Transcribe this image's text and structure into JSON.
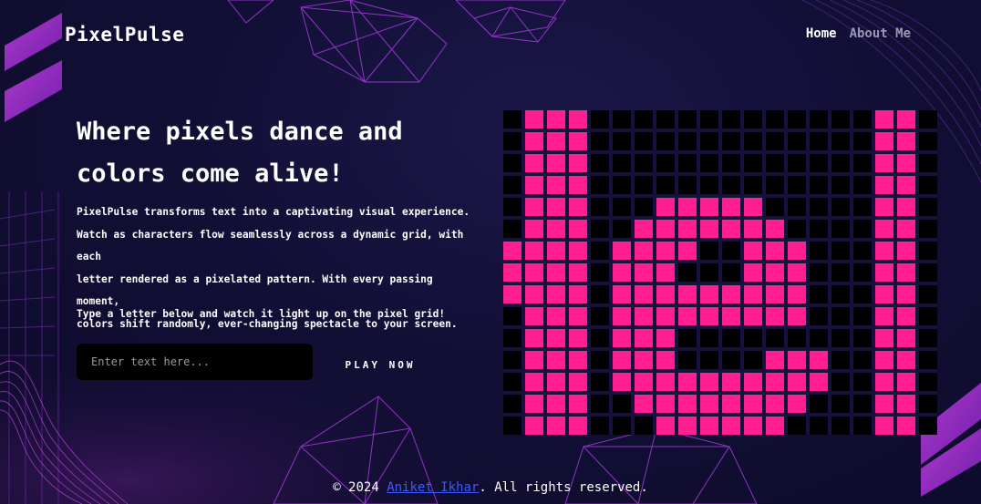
{
  "app": {
    "name": "PixelPulse"
  },
  "nav": {
    "items": [
      {
        "label": "Home"
      },
      {
        "label": "About Me"
      }
    ]
  },
  "hero": {
    "heading_line1": "Where pixels dance and",
    "heading_line2": "colors come alive!",
    "description_lines": [
      "PixelPulse transforms text into a captivating visual experience.",
      "Watch as characters flow seamlessly across a dynamic grid, with each",
      "letter rendered as a pixelated pattern. With every passing moment,",
      "colors shift randomly, ever-changing spectacle to your screen."
    ],
    "prompt": "Type a letter below and watch it light up on the pixel grid!"
  },
  "input": {
    "placeholder": "Enter text here...",
    "value": ""
  },
  "play_button": {
    "label": "PLAY NOW"
  },
  "grid": {
    "columns": 20,
    "rows": 15,
    "on_color": "#ff1f8e",
    "off_color": "#000000",
    "pattern": [
      "01110000000000000110",
      "01110000000000000110",
      "01110000000000000110",
      "01110000000000000110",
      "01110007777700000110",
      "01110077777770000110",
      "11110777700777000110",
      "11110777000777000110",
      "11110777777777000110",
      "01110777777777000110",
      "01110777000000000110",
      "01110777000077700110",
      "01110777777777700110",
      "01110077777777000110",
      "01110007777770000110"
    ]
  },
  "footer": {
    "prefix": "© 2024 ",
    "author": "Aniket Ikhar",
    "suffix": ". All rights reserved."
  },
  "colors": {
    "accent": "#ff1f8e",
    "background": "#120f36",
    "decor": "#a53cdc",
    "link": "#3b5bff"
  }
}
